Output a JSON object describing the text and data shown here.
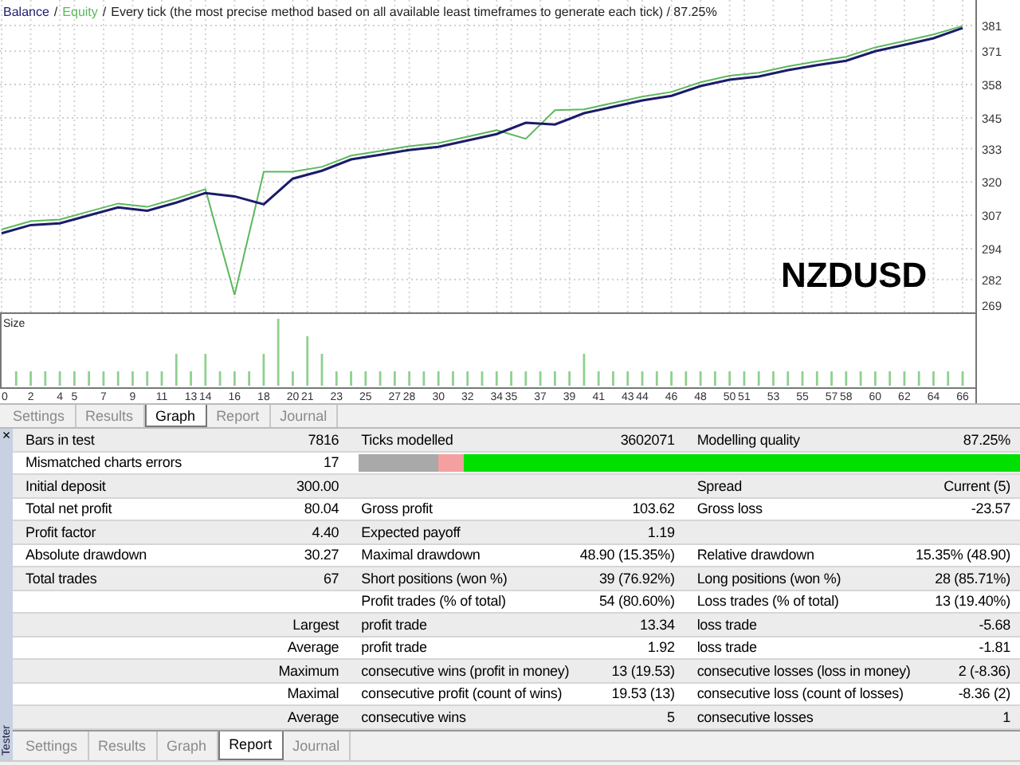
{
  "graph": {
    "legend_separator": "/",
    "symbol": "NZDUSD",
    "size_label": "Size",
    "chart_data": {
      "type": "line",
      "title": "Every tick (the most precise method based on all available least timeframes to generate each tick) / 87.25%",
      "x": [
        0,
        2,
        4,
        6,
        8,
        10,
        12,
        14,
        16,
        18,
        20,
        22,
        24,
        26,
        28,
        30,
        32,
        34,
        36,
        38,
        40,
        42,
        44,
        46,
        48,
        50,
        52,
        54,
        56,
        58,
        60,
        62,
        64,
        66
      ],
      "series": [
        {
          "name": "Balance",
          "color": "#1b1b6b",
          "values": [
            300,
            303.2,
            303.9,
            307,
            310.1,
            308.8,
            312,
            315.7,
            314.4,
            311.3,
            321.3,
            324.4,
            328.8,
            330.6,
            332.5,
            333.7,
            336.2,
            338.7,
            343.1,
            342.4,
            346.8,
            349.3,
            351.8,
            353.6,
            357.4,
            359.9,
            361.1,
            363.6,
            365.5,
            367.3,
            371,
            373.5,
            376,
            380
          ]
        },
        {
          "name": "Equity",
          "color": "#5cb85c",
          "values": [
            301.5,
            304.7,
            305.4,
            308.5,
            311.6,
            310.3,
            313.5,
            317.2,
            276,
            324,
            324,
            325.9,
            330.3,
            332.1,
            334,
            335.2,
            337.7,
            340.2,
            336.8,
            348,
            348.3,
            350.8,
            353.3,
            355.1,
            358.9,
            361.4,
            362.6,
            365.1,
            367,
            368.8,
            372.5,
            375,
            377.5,
            380.8
          ]
        }
      ],
      "xlim": [
        0,
        66
      ],
      "ylim": [
        235,
        381
      ],
      "grid": true,
      "xticks": [
        0,
        2,
        4,
        5,
        7,
        9,
        11,
        13,
        14,
        16,
        18,
        20,
        21,
        23,
        25,
        27,
        28,
        30,
        32,
        34,
        35,
        37,
        39,
        41,
        43,
        44,
        46,
        48,
        50,
        51,
        53,
        55,
        57,
        58,
        60,
        62,
        64,
        66
      ],
      "yticks": [
        269,
        282,
        294,
        307,
        320,
        333,
        345,
        358,
        371,
        381
      ]
    }
  },
  "graph_tabs": [
    {
      "label": "Settings",
      "selected": false
    },
    {
      "label": "Results",
      "selected": false
    },
    {
      "label": "Graph",
      "selected": true
    },
    {
      "label": "Report",
      "selected": false
    },
    {
      "label": "Journal",
      "selected": false
    }
  ],
  "report": {
    "close": "×",
    "tester_label": "Tester",
    "rows": [
      {
        "kind": "pairs",
        "left": {
          "label": "Bars in test",
          "value": "7816"
        },
        "middle": {
          "label": "Ticks modelled",
          "value": "3602071"
        },
        "right": {
          "label": "Modelling quality",
          "value": "87.25%"
        }
      },
      {
        "kind": "quality_bar",
        "left": {
          "label": "Mismatched charts errors",
          "value": "17"
        },
        "level": 0.84
      },
      {
        "kind": "pairs",
        "left": {
          "label": "Initial deposit",
          "value": "300.00"
        },
        "right": {
          "label": "Spread",
          "value": "Current (5)"
        }
      },
      {
        "kind": "pairs",
        "left": {
          "label": "Total net profit",
          "value": "80.04"
        },
        "middle": {
          "label": "Gross profit",
          "value": "103.62"
        },
        "right": {
          "label": "Gross loss",
          "value": "-23.57"
        }
      },
      {
        "kind": "pairs",
        "left": {
          "label": "Profit factor",
          "value": "4.40"
        },
        "middle": {
          "label": "Expected payoff",
          "value": "1.19"
        }
      },
      {
        "kind": "pairs",
        "left": {
          "label": "Absolute drawdown",
          "value": "30.27"
        },
        "middle": {
          "label": "Maximal drawdown",
          "value": "48.90 (15.35%)"
        },
        "right": {
          "label": "Relative drawdown",
          "value": "15.35% (48.90)"
        }
      },
      {
        "kind": "pairs",
        "left": {
          "label": "Total trades",
          "value": "67"
        },
        "middle": {
          "label": "Short positions (won %)",
          "value": "39 (76.92%)"
        },
        "right": {
          "label": "Long positions (won %)",
          "value": "28 (85.71%)"
        }
      },
      {
        "kind": "pairs",
        "middle": {
          "label": "Profit trades (% of total)",
          "value": "54 (80.60%)"
        },
        "right": {
          "label": "Loss trades (% of total)",
          "value": "13 (19.40%)"
        }
      },
      {
        "kind": "pairs",
        "left": {
          "value": "Largest"
        },
        "middle": {
          "label": "profit trade",
          "value": "13.34"
        },
        "right": {
          "label": "loss trade",
          "value": "-5.68"
        }
      },
      {
        "kind": "pairs",
        "left": {
          "value": "Average"
        },
        "middle": {
          "label": "profit trade",
          "value": "1.92"
        },
        "right": {
          "label": "loss trade",
          "value": "-1.81"
        }
      },
      {
        "kind": "pairs",
        "left": {
          "value": "Maximum"
        },
        "middle": {
          "label": "consecutive wins (profit in money)",
          "value": "13 (19.53)"
        },
        "right": {
          "label": "consecutive losses (loss in money)",
          "value": "2 (-8.36)"
        }
      },
      {
        "kind": "pairs",
        "left": {
          "value": "Maximal"
        },
        "middle": {
          "label": "consecutive profit (count of wins)",
          "value": "19.53 (13)"
        },
        "right": {
          "label": "consecutive loss (count of losses)",
          "value": "-8.36 (2)"
        }
      },
      {
        "kind": "pairs",
        "left": {
          "value": "Average"
        },
        "middle": {
          "label": "consecutive wins",
          "value": "5"
        },
        "right": {
          "label": "consecutive losses",
          "value": "1"
        }
      }
    ]
  },
  "bottom_tabs": [
    {
      "label": "Settings",
      "selected": false
    },
    {
      "label": "Results",
      "selected": false
    },
    {
      "label": "Graph",
      "selected": false
    },
    {
      "label": "Report",
      "selected": true
    },
    {
      "label": "Journal",
      "selected": false
    }
  ]
}
